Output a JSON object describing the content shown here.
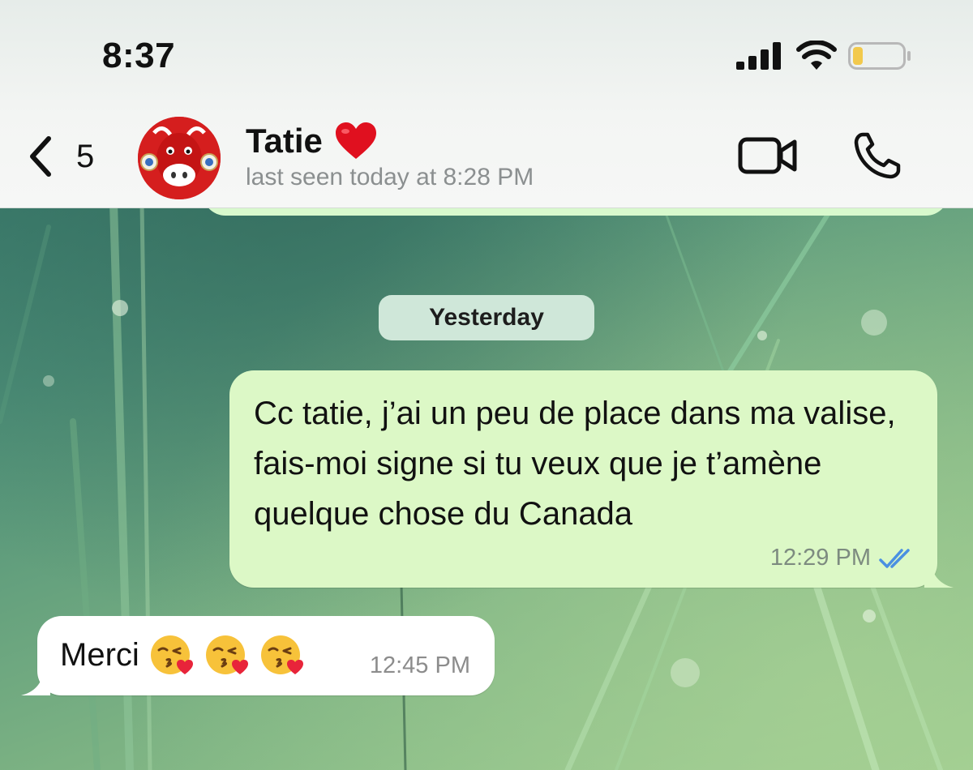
{
  "status_bar": {
    "time": "8:37"
  },
  "header": {
    "back_count": "5",
    "contact_name": "Tatie",
    "last_seen": "last seen today at 8:28 PM",
    "name_emoji": "heart-icon"
  },
  "chat": {
    "date_divider": "Yesterday",
    "messages": [
      {
        "direction": "outgoing",
        "text": "Cc tatie, j’ai un peu de place dans ma valise, fais-moi signe si tu veux que je t’amène quelque chose du Canada",
        "time": "12:29 PM",
        "status": "read",
        "ticks_color": "#4a90e2"
      },
      {
        "direction": "incoming",
        "text": "Merci",
        "emojis": [
          "kissing-face-with-heart",
          "kissing-face-with-heart",
          "kissing-face-with-heart"
        ],
        "time": "12:45 PM"
      }
    ]
  },
  "colors": {
    "outgoing_bubble": "#dcf8c6",
    "incoming_bubble": "#ffffff",
    "date_chip": "#cfe7d9",
    "battery_level": "#f2c94c"
  },
  "battery": {
    "level": 0.2
  }
}
